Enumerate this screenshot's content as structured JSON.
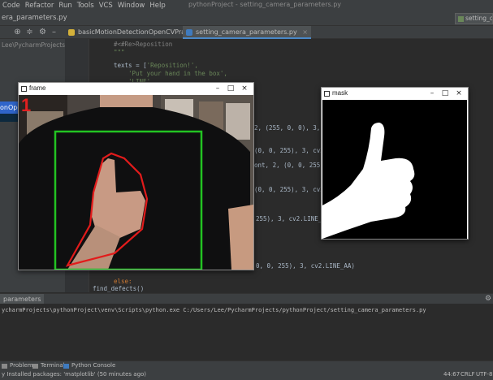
{
  "menu": [
    "Code",
    "Refactor",
    "Run",
    "Tools",
    "VCS",
    "Window",
    "Help"
  ],
  "window_title": "pythonProject - setting_camera_parameters.py",
  "breadcrumb": "era_parameters.py",
  "run_config": "setting_cam",
  "project_path": "Lee\\PycharmProjects",
  "project_selected": "onOpe",
  "tabs": [
    {
      "label": "basicMotionDetectionOpenCVPractice",
      "active": false
    },
    {
      "label": "setting_camera_parameters.py",
      "active": true
    }
  ],
  "code": {
    "l1": "#<#Re>Reposition",
    "l2": "\"\"\"",
    "l3_var": "texts = [",
    "l3_str": "'Reposition!',",
    "l4": "'Put your hand in the box',",
    "l5": "'LINE'",
    "l6": "2, (255, 0, 0), 3, cv2.L",
    "l7": "(0, 0, 255), 3, cv2.L",
    "l8": "ont, 2, (0, 0, 255), 3, cv2",
    "l9": "(0, 0, 255), 3, cv2.L",
    "l10": "255), 3, cv2.LINE_AA)",
    "l11": "0, 0, 255), 3, cv2.LINE_AA)",
    "l12_kw": "else:",
    "l13": "find_defects()"
  },
  "run": {
    "tab_label": "parameters",
    "console": "ycharmProjects\\pythonProject\\venv\\Scripts\\python.exe C:/Users/Lee/PycharmProjects/pythonProject/setting_camera_parameters.py"
  },
  "bottom_tabs": [
    "Problems",
    "Terminal",
    "Python Console"
  ],
  "status": {
    "message": "y Installed packages: 'matplotlib' (50 minutes ago)",
    "position": "44:67",
    "line_sep": "CRLF",
    "encoding": "UTF-8"
  },
  "frame_window": {
    "title": "frame",
    "counter": "1"
  },
  "mask_window": {
    "title": "mask"
  },
  "colors": {
    "detection_box": "#22c322",
    "contour": "#e21b1b",
    "ide_bg": "#2b2b2b",
    "ide_panel": "#3c3f41"
  }
}
